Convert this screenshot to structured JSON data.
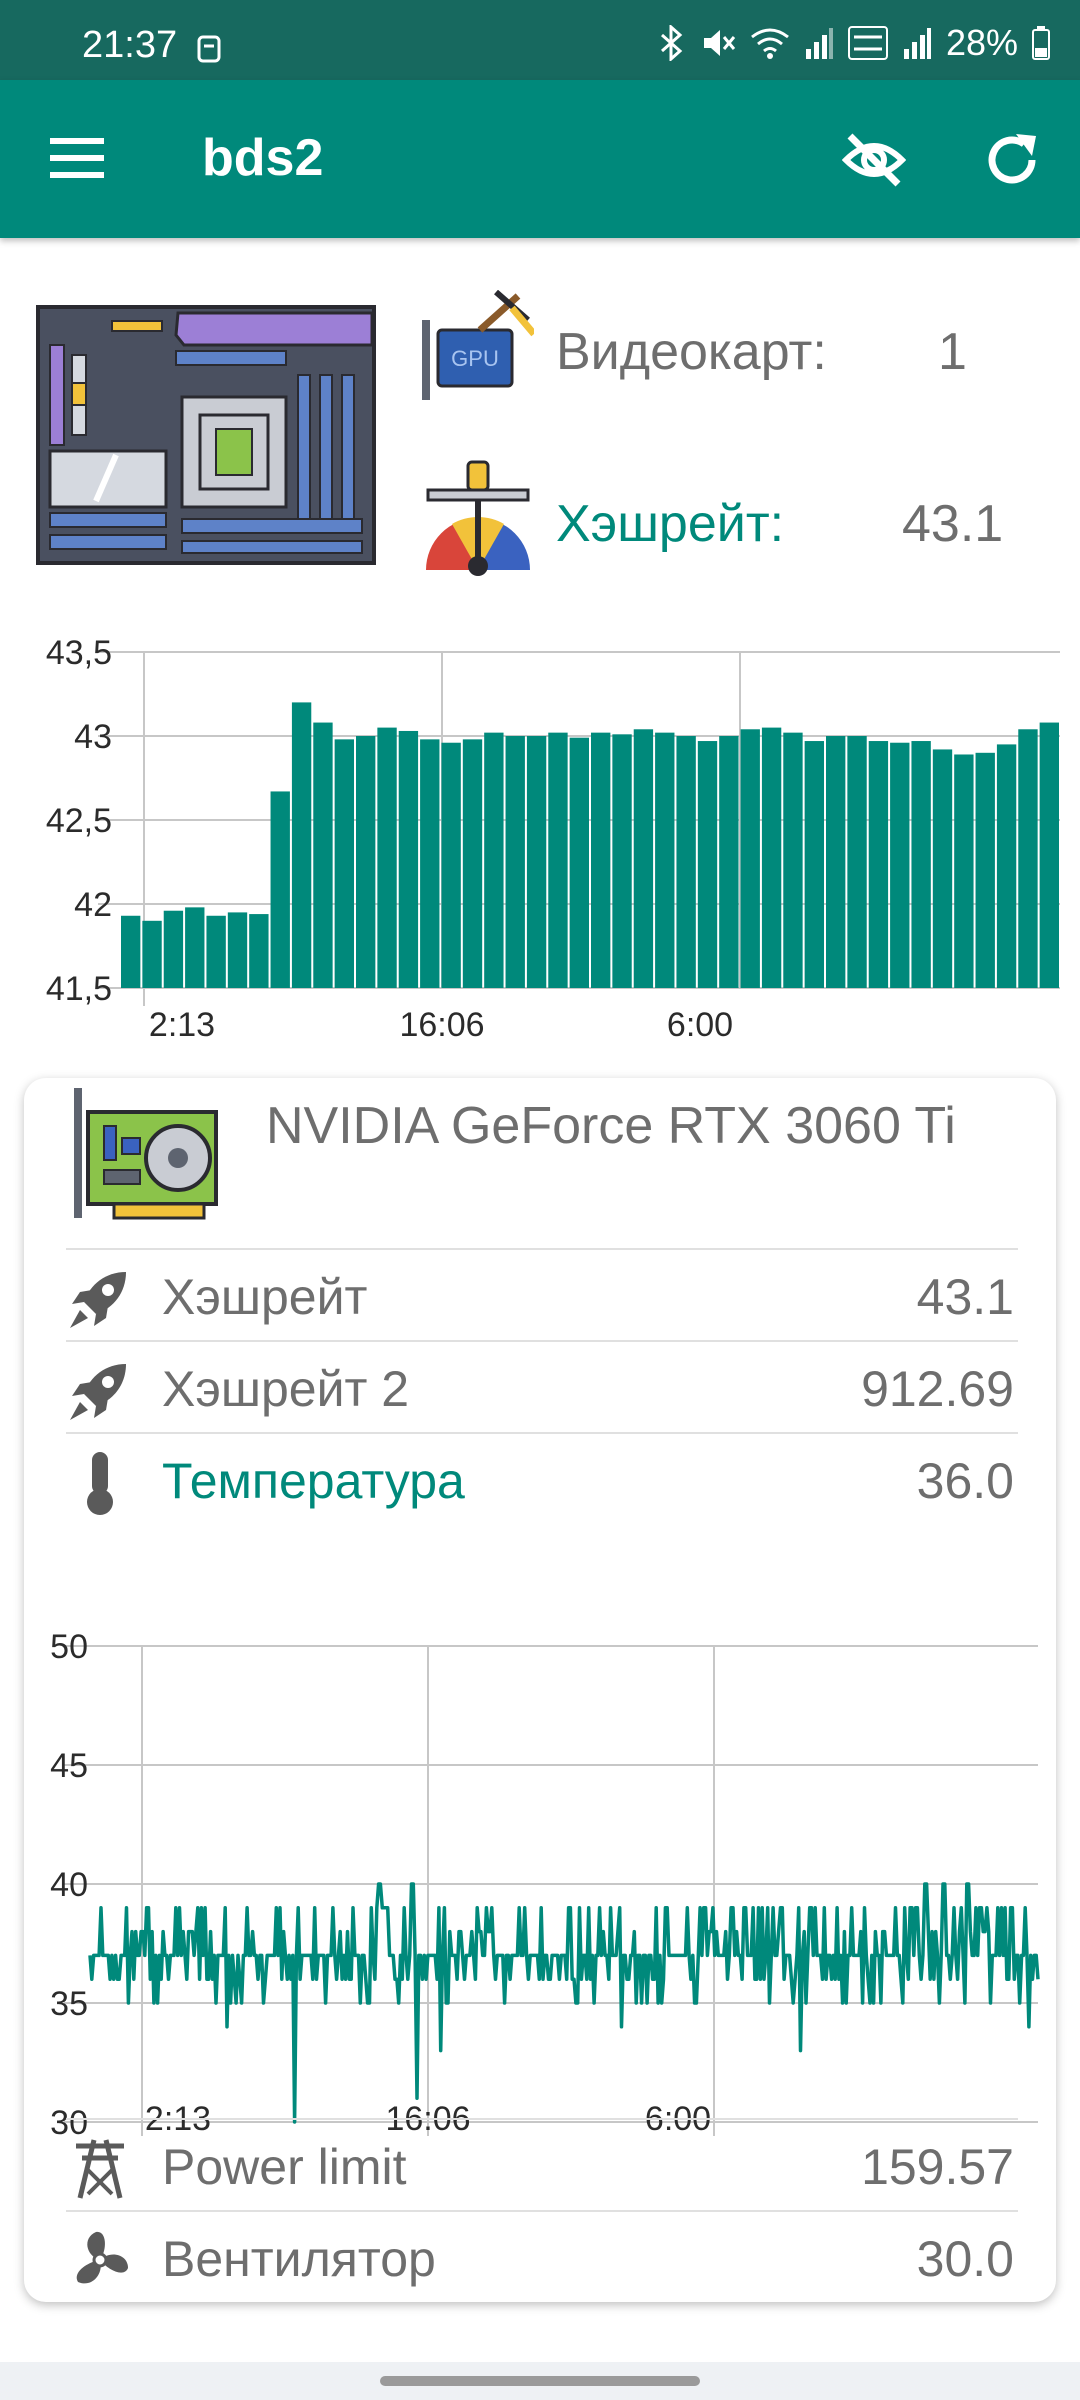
{
  "status_bar": {
    "time": "21:37",
    "battery": "28%"
  },
  "app_bar": {
    "title": "bds2"
  },
  "summary": {
    "gpu_count_label": "Видеокарт:",
    "gpu_count_value": "1",
    "hashrate_label": "Хэшрейт:",
    "hashrate_value": "43.1"
  },
  "colors": {
    "accent": "#00897b",
    "status_bar": "#17695f",
    "text": "#6e6e6e"
  },
  "chart_data": [
    {
      "type": "bar",
      "y_tick_labels": [
        "41,5",
        "42",
        "42,5",
        "43",
        "43,5"
      ],
      "x_tick_labels": [
        "2:13",
        "16:06",
        "6:00"
      ],
      "ylim": [
        41.5,
        43.5
      ],
      "grid": true,
      "values": [
        41.93,
        41.9,
        41.96,
        41.98,
        41.93,
        41.95,
        41.94,
        42.67,
        43.2,
        43.08,
        42.98,
        43.0,
        43.05,
        43.03,
        42.98,
        42.96,
        42.98,
        43.02,
        43.0,
        43.0,
        43.02,
        42.99,
        43.02,
        43.01,
        43.04,
        43.02,
        43.0,
        42.97,
        43.0,
        43.04,
        43.05,
        43.02,
        42.97,
        43.0,
        43.0,
        42.97,
        42.96,
        42.97,
        42.92,
        42.89,
        42.9,
        42.95,
        43.04,
        43.08
      ]
    },
    {
      "type": "line",
      "y_tick_labels": [
        "30",
        "35",
        "40",
        "45",
        "50"
      ],
      "x_tick_labels": [
        "2:13",
        "16:06",
        "6:00"
      ],
      "ylim": [
        30,
        50
      ],
      "grid": true,
      "base_value": 37,
      "spikes": [
        [
          0.215,
          30
        ],
        [
          0.345,
          31
        ],
        [
          0.37,
          33
        ],
        [
          0.56,
          34
        ],
        [
          0.75,
          33
        ],
        [
          0.755,
          35
        ],
        [
          0.88,
          40
        ],
        [
          0.9,
          40
        ],
        [
          0.925,
          40
        ],
        [
          0.34,
          40
        ],
        [
          0.305,
          40
        ],
        [
          0.98,
          35
        ],
        [
          0.99,
          34
        ],
        [
          0.145,
          34
        ],
        [
          0.155,
          35
        ],
        [
          0.6,
          35
        ],
        [
          0.64,
          35
        ]
      ]
    }
  ],
  "gpu": {
    "name": "NVIDIA GeForce RTX 3060 Ti",
    "hashrate_label": "Хэшрейт",
    "hashrate_value": "43.1",
    "hashrate2_label": "Хэшрейт 2",
    "hashrate2_value": "912.69",
    "temperature_label": "Температура",
    "temperature_value": "36.0",
    "power_label": "Power limit",
    "power_value": "159.57",
    "fan_label": "Вентилятор",
    "fan_value": "30.0"
  }
}
